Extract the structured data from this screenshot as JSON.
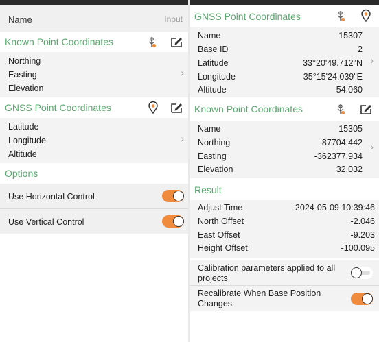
{
  "left": {
    "namebar": {
      "name_label": "Name",
      "input_label": "Input"
    },
    "known": {
      "title": "Known Point Coordinates",
      "rows": [
        "Northing",
        "Easting",
        "Elevation"
      ]
    },
    "gnss": {
      "title": "GNSS Point Coordinates",
      "rows": [
        "Latitude",
        "Longitude",
        "Altitude"
      ]
    },
    "options": {
      "title": "Options",
      "items": [
        {
          "label": "Use Horizontal Control",
          "on": true
        },
        {
          "label": "Use Vertical Control",
          "on": true
        }
      ]
    }
  },
  "right": {
    "gnss": {
      "title": "GNSS Point Coordinates",
      "rows": [
        {
          "label": "Name",
          "value": "15307"
        },
        {
          "label": "Base ID",
          "value": "2"
        },
        {
          "label": "Latitude",
          "value": "33°20'49.712\"N"
        },
        {
          "label": "Longitude",
          "value": "35°15'24.039\"E"
        },
        {
          "label": "Altitude",
          "value": "54.060"
        }
      ]
    },
    "known": {
      "title": "Known Point Coordinates",
      "rows": [
        {
          "label": "Name",
          "value": "15305"
        },
        {
          "label": "Northing",
          "value": "-87704.442"
        },
        {
          "label": "Easting",
          "value": "-362377.934"
        },
        {
          "label": "Elevation",
          "value": "32.032"
        }
      ]
    },
    "result": {
      "title": "Result",
      "rows": [
        {
          "label": "Adjust Time",
          "value": "2024-05-09 10:39:46"
        },
        {
          "label": "North Offset",
          "value": "-2.046"
        },
        {
          "label": "East Offset",
          "value": "-9.203"
        },
        {
          "label": "Height Offset",
          "value": "-100.095"
        }
      ]
    },
    "settings": [
      {
        "label": "Calibration parameters applied to all projects",
        "on": false
      },
      {
        "label": "Recalibrate When Base Position Changes",
        "on": true
      }
    ]
  },
  "colors": {
    "accent_green": "#5aa86f",
    "toggle_on": "#f08a3c",
    "header_bar": "#2b2b2b"
  },
  "icons": [
    "rover-survey-icon",
    "edit-icon",
    "location-pin-icon",
    "chevron-right-icon"
  ]
}
